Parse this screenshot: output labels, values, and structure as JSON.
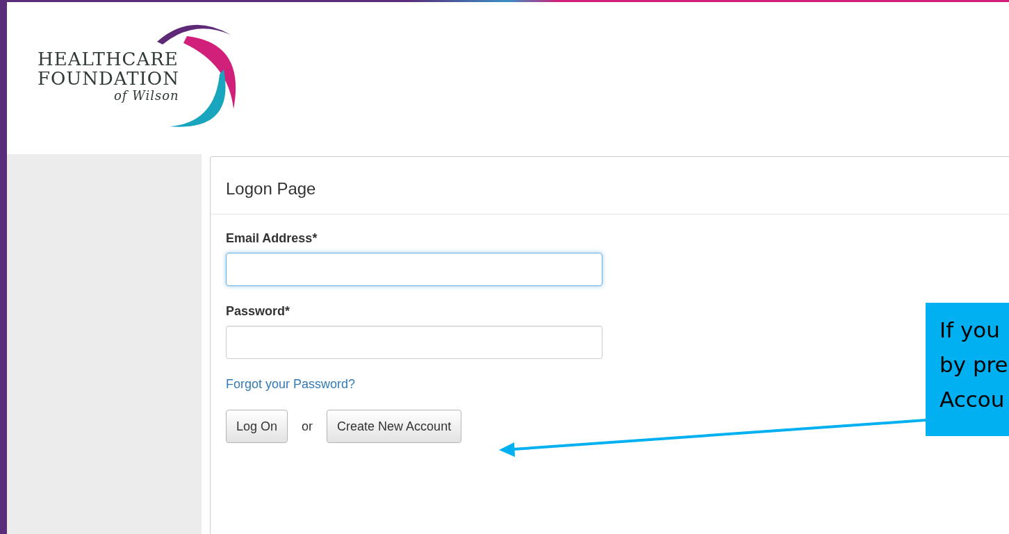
{
  "logo": {
    "line_1": "HEALTHCARE",
    "line_2": "FOUNDATION",
    "line_3": "of Wilson"
  },
  "panel": {
    "title": "Logon Page",
    "fields": [
      {
        "label": "Email Address*",
        "focused": true
      },
      {
        "label": "Password*",
        "focused": false
      }
    ],
    "link": "Forgot your Password?",
    "buttons": [
      "Log On",
      "Create New Account"
    ],
    "separator": "or"
  },
  "callout": {
    "lines": [
      "If you",
      "by pre",
      "Accou"
    ]
  }
}
